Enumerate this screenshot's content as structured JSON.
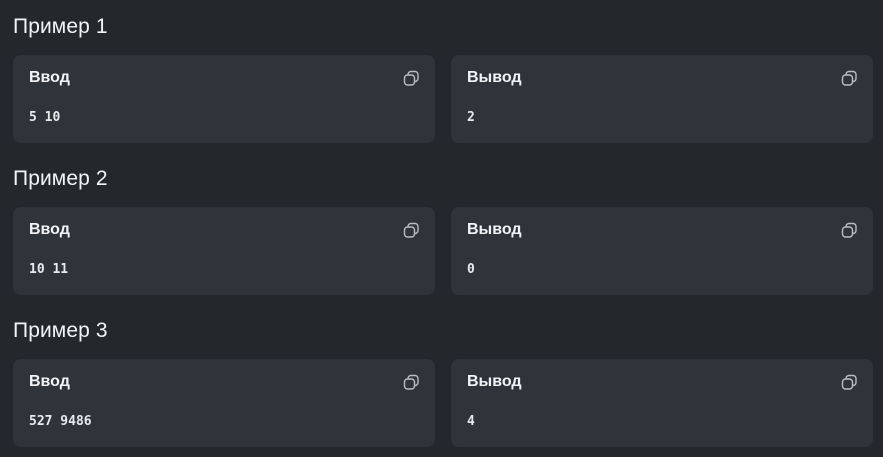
{
  "examples": [
    {
      "title": "Пример 1",
      "input": {
        "label": "Ввод",
        "value": "5 10",
        "copy_icon": "copy-icon"
      },
      "output": {
        "label": "Вывод",
        "value": "2",
        "copy_icon": "copy-icon"
      }
    },
    {
      "title": "Пример 2",
      "input": {
        "label": "Ввод",
        "value": "10 11",
        "copy_icon": "copy-icon"
      },
      "output": {
        "label": "Вывод",
        "value": "0",
        "copy_icon": "copy-icon"
      }
    },
    {
      "title": "Пример 3",
      "input": {
        "label": "Ввод",
        "value": "527 9486",
        "copy_icon": "copy-icon"
      },
      "output": {
        "label": "Вывод",
        "value": "4",
        "copy_icon": "copy-icon"
      }
    }
  ],
  "colors": {
    "page_background": "#24282d",
    "panel_background": "#2f343b",
    "text": "#f1f3f5",
    "icon": "#b9bec6"
  }
}
